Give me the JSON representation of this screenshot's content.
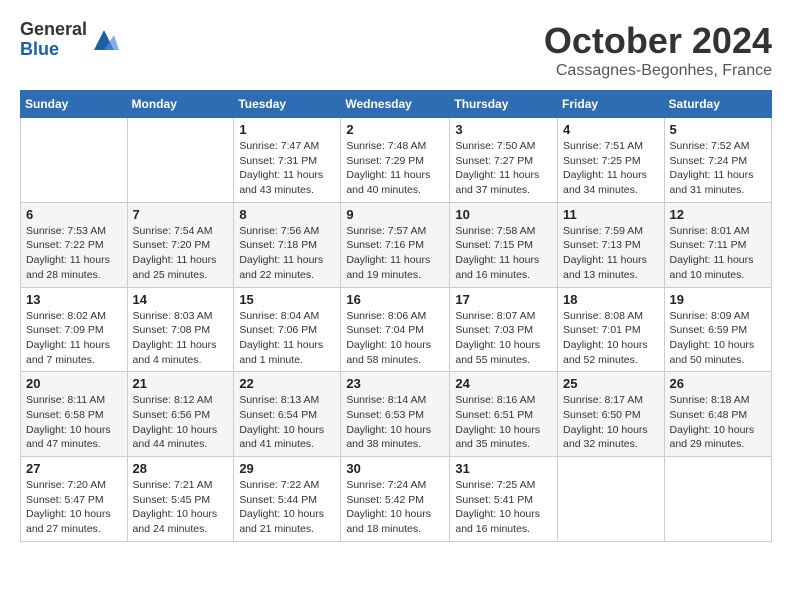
{
  "logo": {
    "general": "General",
    "blue": "Blue"
  },
  "title": "October 2024",
  "location": "Cassagnes-Begonhes, France",
  "days_header": [
    "Sunday",
    "Monday",
    "Tuesday",
    "Wednesday",
    "Thursday",
    "Friday",
    "Saturday"
  ],
  "weeks": [
    [
      {
        "day": "",
        "info": ""
      },
      {
        "day": "",
        "info": ""
      },
      {
        "day": "1",
        "info": "Sunrise: 7:47 AM\nSunset: 7:31 PM\nDaylight: 11 hours and 43 minutes."
      },
      {
        "day": "2",
        "info": "Sunrise: 7:48 AM\nSunset: 7:29 PM\nDaylight: 11 hours and 40 minutes."
      },
      {
        "day": "3",
        "info": "Sunrise: 7:50 AM\nSunset: 7:27 PM\nDaylight: 11 hours and 37 minutes."
      },
      {
        "day": "4",
        "info": "Sunrise: 7:51 AM\nSunset: 7:25 PM\nDaylight: 11 hours and 34 minutes."
      },
      {
        "day": "5",
        "info": "Sunrise: 7:52 AM\nSunset: 7:24 PM\nDaylight: 11 hours and 31 minutes."
      }
    ],
    [
      {
        "day": "6",
        "info": "Sunrise: 7:53 AM\nSunset: 7:22 PM\nDaylight: 11 hours and 28 minutes."
      },
      {
        "day": "7",
        "info": "Sunrise: 7:54 AM\nSunset: 7:20 PM\nDaylight: 11 hours and 25 minutes."
      },
      {
        "day": "8",
        "info": "Sunrise: 7:56 AM\nSunset: 7:18 PM\nDaylight: 11 hours and 22 minutes."
      },
      {
        "day": "9",
        "info": "Sunrise: 7:57 AM\nSunset: 7:16 PM\nDaylight: 11 hours and 19 minutes."
      },
      {
        "day": "10",
        "info": "Sunrise: 7:58 AM\nSunset: 7:15 PM\nDaylight: 11 hours and 16 minutes."
      },
      {
        "day": "11",
        "info": "Sunrise: 7:59 AM\nSunset: 7:13 PM\nDaylight: 11 hours and 13 minutes."
      },
      {
        "day": "12",
        "info": "Sunrise: 8:01 AM\nSunset: 7:11 PM\nDaylight: 11 hours and 10 minutes."
      }
    ],
    [
      {
        "day": "13",
        "info": "Sunrise: 8:02 AM\nSunset: 7:09 PM\nDaylight: 11 hours and 7 minutes."
      },
      {
        "day": "14",
        "info": "Sunrise: 8:03 AM\nSunset: 7:08 PM\nDaylight: 11 hours and 4 minutes."
      },
      {
        "day": "15",
        "info": "Sunrise: 8:04 AM\nSunset: 7:06 PM\nDaylight: 11 hours and 1 minute."
      },
      {
        "day": "16",
        "info": "Sunrise: 8:06 AM\nSunset: 7:04 PM\nDaylight: 10 hours and 58 minutes."
      },
      {
        "day": "17",
        "info": "Sunrise: 8:07 AM\nSunset: 7:03 PM\nDaylight: 10 hours and 55 minutes."
      },
      {
        "day": "18",
        "info": "Sunrise: 8:08 AM\nSunset: 7:01 PM\nDaylight: 10 hours and 52 minutes."
      },
      {
        "day": "19",
        "info": "Sunrise: 8:09 AM\nSunset: 6:59 PM\nDaylight: 10 hours and 50 minutes."
      }
    ],
    [
      {
        "day": "20",
        "info": "Sunrise: 8:11 AM\nSunset: 6:58 PM\nDaylight: 10 hours and 47 minutes."
      },
      {
        "day": "21",
        "info": "Sunrise: 8:12 AM\nSunset: 6:56 PM\nDaylight: 10 hours and 44 minutes."
      },
      {
        "day": "22",
        "info": "Sunrise: 8:13 AM\nSunset: 6:54 PM\nDaylight: 10 hours and 41 minutes."
      },
      {
        "day": "23",
        "info": "Sunrise: 8:14 AM\nSunset: 6:53 PM\nDaylight: 10 hours and 38 minutes."
      },
      {
        "day": "24",
        "info": "Sunrise: 8:16 AM\nSunset: 6:51 PM\nDaylight: 10 hours and 35 minutes."
      },
      {
        "day": "25",
        "info": "Sunrise: 8:17 AM\nSunset: 6:50 PM\nDaylight: 10 hours and 32 minutes."
      },
      {
        "day": "26",
        "info": "Sunrise: 8:18 AM\nSunset: 6:48 PM\nDaylight: 10 hours and 29 minutes."
      }
    ],
    [
      {
        "day": "27",
        "info": "Sunrise: 7:20 AM\nSunset: 5:47 PM\nDaylight: 10 hours and 27 minutes."
      },
      {
        "day": "28",
        "info": "Sunrise: 7:21 AM\nSunset: 5:45 PM\nDaylight: 10 hours and 24 minutes."
      },
      {
        "day": "29",
        "info": "Sunrise: 7:22 AM\nSunset: 5:44 PM\nDaylight: 10 hours and 21 minutes."
      },
      {
        "day": "30",
        "info": "Sunrise: 7:24 AM\nSunset: 5:42 PM\nDaylight: 10 hours and 18 minutes."
      },
      {
        "day": "31",
        "info": "Sunrise: 7:25 AM\nSunset: 5:41 PM\nDaylight: 10 hours and 16 minutes."
      },
      {
        "day": "",
        "info": ""
      },
      {
        "day": "",
        "info": ""
      }
    ]
  ]
}
